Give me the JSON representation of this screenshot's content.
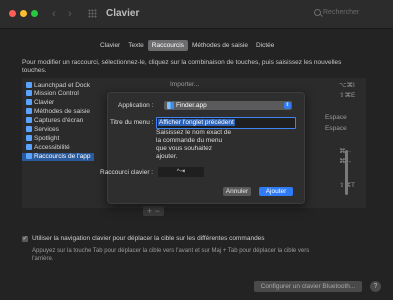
{
  "window": {
    "title": "Clavier",
    "search_placeholder": "Rechercher",
    "icons": [
      "close",
      "minimize",
      "maximize",
      "back-arrow",
      "forward-arrow",
      "grid-icon",
      "search-icon"
    ]
  },
  "tabs": [
    {
      "label": "Clavier"
    },
    {
      "label": "Texte"
    },
    {
      "label": "Raccourcis"
    },
    {
      "label": "Méthodes de saisie"
    },
    {
      "label": "Dictée"
    }
  ],
  "selected_tab": "Raccourcis",
  "instructions": "Pour modifier un raccourci, sélectionnez-le, cliquez sur la combinaison de touches, puis saisissez les nouvelles touches.",
  "categories": [
    {
      "label": "Launchpad et Dock"
    },
    {
      "label": "Mission Control"
    },
    {
      "label": "Clavier"
    },
    {
      "label": "Méthodes de saisie"
    },
    {
      "label": "Captures d'écran"
    },
    {
      "label": "Services"
    },
    {
      "label": "Spotlight"
    },
    {
      "label": "Accessibilité"
    },
    {
      "label": "Raccourcis de l'app"
    }
  ],
  "right_list": {
    "header_partial": "Importer...",
    "shortcuts": [
      "⌥⌘I",
      "⇧⌘E",
      "Espace",
      "Espace",
      "⌘←",
      "⌘→",
      "⇧⌘T"
    ]
  },
  "add_remove": {
    "label": "+ −"
  },
  "dialog": {
    "app_label": "Application :",
    "app_value": "Finder.app",
    "menu_title_label": "Titre du menu :",
    "menu_title_value": "Afficher l'onglet précédent",
    "tooltip": "Saisissez le nom exact de la commande du menu que vous souhaitez ajouter.",
    "shortcut_label": "Raccourci clavier :",
    "shortcut_value": "^⇥",
    "cancel_label": "Annuler",
    "add_label": "Ajouter"
  },
  "nav_checkbox": {
    "checked": true,
    "label": "Utiliser la navigation clavier pour déplacer la cible sur les différentes commandes"
  },
  "nav_hint": "Appuyez sur la touche Tab pour déplacer la cible vers l'avant et sur Maj + Tab pour déplacer la cible vers l'arrière.",
  "bt_button": {
    "label": "Configurer un clavier Bluetooth..."
  },
  "help_button": {
    "label": "?"
  },
  "colors": {
    "accent": "#2f7cf6",
    "selection": "#2a5a9b",
    "window_bg": "#232324"
  }
}
